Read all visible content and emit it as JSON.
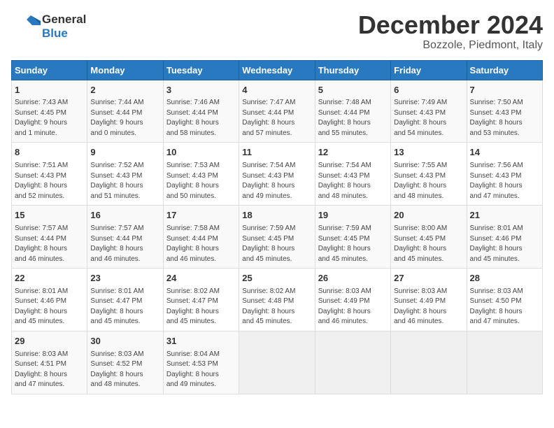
{
  "header": {
    "logo_line1": "General",
    "logo_line2": "Blue",
    "month": "December 2024",
    "location": "Bozzole, Piedmont, Italy"
  },
  "days_of_week": [
    "Sunday",
    "Monday",
    "Tuesday",
    "Wednesday",
    "Thursday",
    "Friday",
    "Saturday"
  ],
  "weeks": [
    [
      {
        "day": "1",
        "info": "Sunrise: 7:43 AM\nSunset: 4:45 PM\nDaylight: 9 hours\nand 1 minute."
      },
      {
        "day": "2",
        "info": "Sunrise: 7:44 AM\nSunset: 4:44 PM\nDaylight: 9 hours\nand 0 minutes."
      },
      {
        "day": "3",
        "info": "Sunrise: 7:46 AM\nSunset: 4:44 PM\nDaylight: 8 hours\nand 58 minutes."
      },
      {
        "day": "4",
        "info": "Sunrise: 7:47 AM\nSunset: 4:44 PM\nDaylight: 8 hours\nand 57 minutes."
      },
      {
        "day": "5",
        "info": "Sunrise: 7:48 AM\nSunset: 4:44 PM\nDaylight: 8 hours\nand 55 minutes."
      },
      {
        "day": "6",
        "info": "Sunrise: 7:49 AM\nSunset: 4:43 PM\nDaylight: 8 hours\nand 54 minutes."
      },
      {
        "day": "7",
        "info": "Sunrise: 7:50 AM\nSunset: 4:43 PM\nDaylight: 8 hours\nand 53 minutes."
      }
    ],
    [
      {
        "day": "8",
        "info": "Sunrise: 7:51 AM\nSunset: 4:43 PM\nDaylight: 8 hours\nand 52 minutes."
      },
      {
        "day": "9",
        "info": "Sunrise: 7:52 AM\nSunset: 4:43 PM\nDaylight: 8 hours\nand 51 minutes."
      },
      {
        "day": "10",
        "info": "Sunrise: 7:53 AM\nSunset: 4:43 PM\nDaylight: 8 hours\nand 50 minutes."
      },
      {
        "day": "11",
        "info": "Sunrise: 7:54 AM\nSunset: 4:43 PM\nDaylight: 8 hours\nand 49 minutes."
      },
      {
        "day": "12",
        "info": "Sunrise: 7:54 AM\nSunset: 4:43 PM\nDaylight: 8 hours\nand 48 minutes."
      },
      {
        "day": "13",
        "info": "Sunrise: 7:55 AM\nSunset: 4:43 PM\nDaylight: 8 hours\nand 48 minutes."
      },
      {
        "day": "14",
        "info": "Sunrise: 7:56 AM\nSunset: 4:43 PM\nDaylight: 8 hours\nand 47 minutes."
      }
    ],
    [
      {
        "day": "15",
        "info": "Sunrise: 7:57 AM\nSunset: 4:44 PM\nDaylight: 8 hours\nand 46 minutes."
      },
      {
        "day": "16",
        "info": "Sunrise: 7:57 AM\nSunset: 4:44 PM\nDaylight: 8 hours\nand 46 minutes."
      },
      {
        "day": "17",
        "info": "Sunrise: 7:58 AM\nSunset: 4:44 PM\nDaylight: 8 hours\nand 46 minutes."
      },
      {
        "day": "18",
        "info": "Sunrise: 7:59 AM\nSunset: 4:45 PM\nDaylight: 8 hours\nand 45 minutes."
      },
      {
        "day": "19",
        "info": "Sunrise: 7:59 AM\nSunset: 4:45 PM\nDaylight: 8 hours\nand 45 minutes."
      },
      {
        "day": "20",
        "info": "Sunrise: 8:00 AM\nSunset: 4:45 PM\nDaylight: 8 hours\nand 45 minutes."
      },
      {
        "day": "21",
        "info": "Sunrise: 8:01 AM\nSunset: 4:46 PM\nDaylight: 8 hours\nand 45 minutes."
      }
    ],
    [
      {
        "day": "22",
        "info": "Sunrise: 8:01 AM\nSunset: 4:46 PM\nDaylight: 8 hours\nand 45 minutes."
      },
      {
        "day": "23",
        "info": "Sunrise: 8:01 AM\nSunset: 4:47 PM\nDaylight: 8 hours\nand 45 minutes."
      },
      {
        "day": "24",
        "info": "Sunrise: 8:02 AM\nSunset: 4:47 PM\nDaylight: 8 hours\nand 45 minutes."
      },
      {
        "day": "25",
        "info": "Sunrise: 8:02 AM\nSunset: 4:48 PM\nDaylight: 8 hours\nand 45 minutes."
      },
      {
        "day": "26",
        "info": "Sunrise: 8:03 AM\nSunset: 4:49 PM\nDaylight: 8 hours\nand 46 minutes."
      },
      {
        "day": "27",
        "info": "Sunrise: 8:03 AM\nSunset: 4:49 PM\nDaylight: 8 hours\nand 46 minutes."
      },
      {
        "day": "28",
        "info": "Sunrise: 8:03 AM\nSunset: 4:50 PM\nDaylight: 8 hours\nand 47 minutes."
      }
    ],
    [
      {
        "day": "29",
        "info": "Sunrise: 8:03 AM\nSunset: 4:51 PM\nDaylight: 8 hours\nand 47 minutes."
      },
      {
        "day": "30",
        "info": "Sunrise: 8:03 AM\nSunset: 4:52 PM\nDaylight: 8 hours\nand 48 minutes."
      },
      {
        "day": "31",
        "info": "Sunrise: 8:04 AM\nSunset: 4:53 PM\nDaylight: 8 hours\nand 49 minutes."
      },
      {
        "day": "",
        "info": ""
      },
      {
        "day": "",
        "info": ""
      },
      {
        "day": "",
        "info": ""
      },
      {
        "day": "",
        "info": ""
      }
    ]
  ]
}
